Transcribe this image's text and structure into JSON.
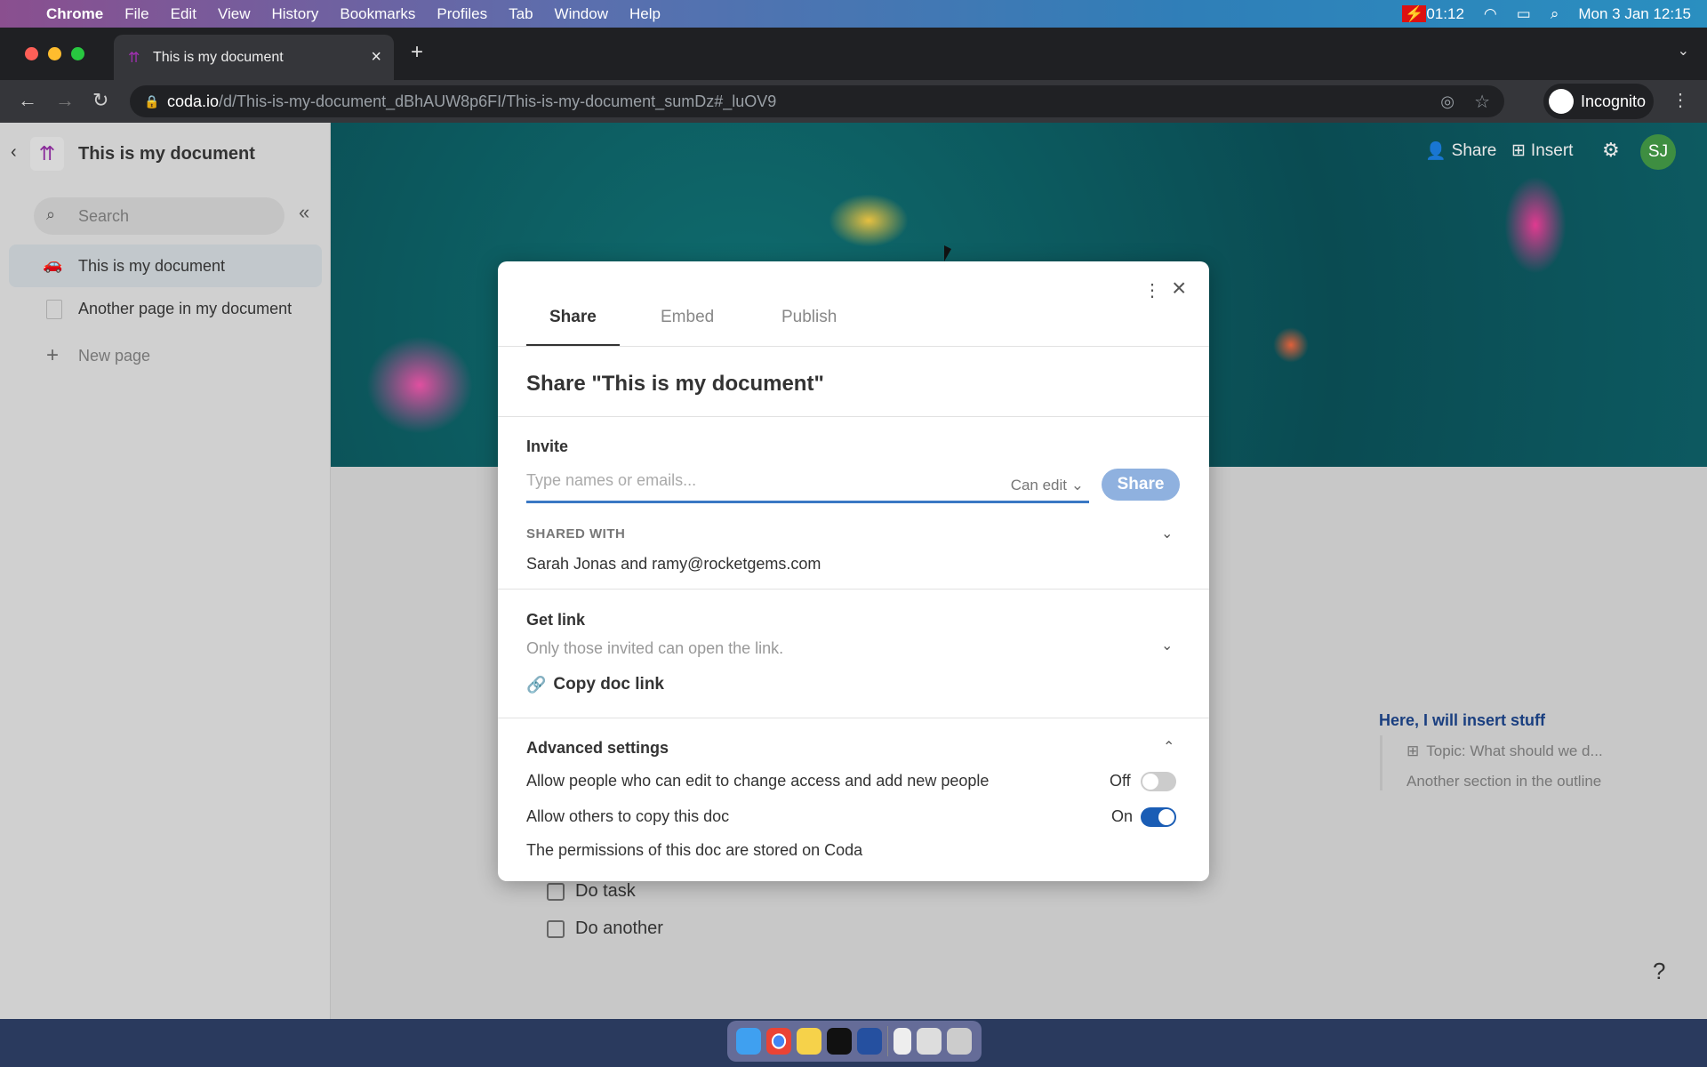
{
  "menubar": {
    "app": "Chrome",
    "items": [
      "File",
      "Edit",
      "View",
      "History",
      "Bookmarks",
      "Profiles",
      "Tab",
      "Window",
      "Help"
    ],
    "timer": "01:12",
    "datetime": "Mon 3 Jan  12:15"
  },
  "browser": {
    "tab_title": "This is my document",
    "url_host": "coda.io",
    "url_path": "/d/This-is-my-document_dBhAUW8p6FI/This-is-my-document_sumDz#_luOV9",
    "profile": "Incognito"
  },
  "sidebar": {
    "doc_title": "This is my document",
    "search_placeholder": "Search",
    "pages": [
      {
        "label": "This is my document",
        "icon": "car-icon",
        "selected": true
      },
      {
        "label": "Another page in my document",
        "icon": "page-icon"
      }
    ],
    "new_page": "New page"
  },
  "header": {
    "share": "Share",
    "insert": "Insert",
    "avatar": "SJ",
    "avatar_color": "#3e8e41"
  },
  "content": {
    "tasks": [
      "Do task",
      "Do another"
    ],
    "outline": {
      "heading": "Here, I will insert stuff",
      "items": [
        "Topic: What should we d...",
        "Another section in the outline"
      ]
    },
    "help": "?"
  },
  "dialog": {
    "tabs": [
      "Share",
      "Embed",
      "Publish"
    ],
    "active_tab": "Share",
    "title": "Share \"This is my document\"",
    "invite": {
      "label": "Invite",
      "placeholder": "Type names or emails...",
      "permission": "Can edit",
      "button": "Share"
    },
    "shared_with": {
      "label": "SHARED WITH",
      "value": "Sarah Jonas and ramy@rocketgems.com"
    },
    "get_link": {
      "label": "Get link",
      "description": "Only those invited can open the link.",
      "copy": "Copy doc link"
    },
    "advanced": {
      "label": "Advanced settings",
      "settings": [
        {
          "label": "Allow people who can edit to change access and add new people",
          "state": "Off",
          "on": false
        },
        {
          "label": "Allow others to copy this doc",
          "state": "On",
          "on": true
        }
      ],
      "footer": "The permissions of this doc are stored on Coda"
    },
    "accent": "#1a5db5"
  }
}
